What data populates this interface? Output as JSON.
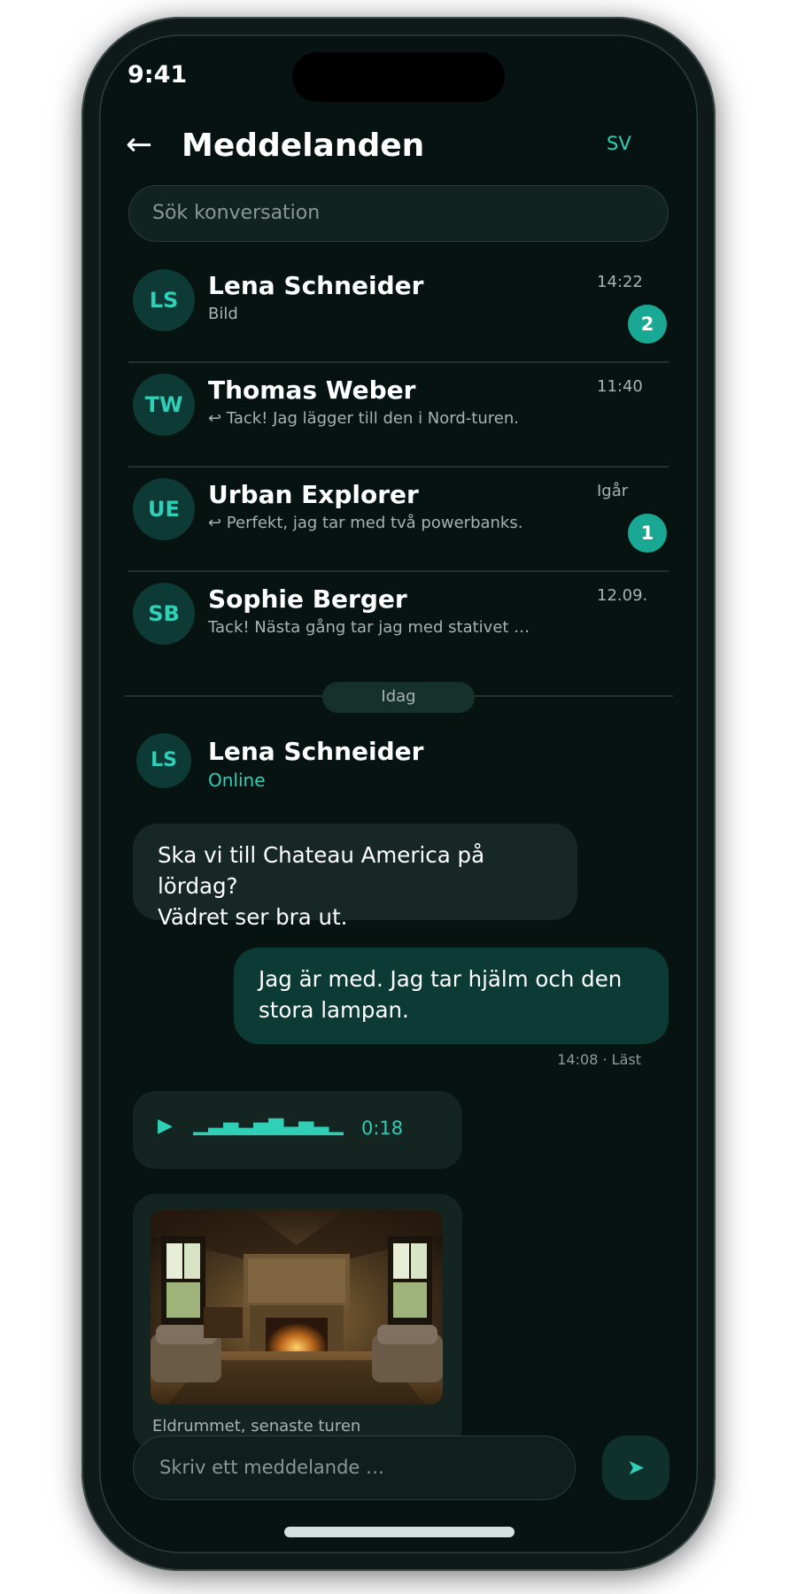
{
  "status_bar": {
    "time": "9:41"
  },
  "header": {
    "back_icon": "arrow-left-icon",
    "back_glyph": "←",
    "title": "Meddelanden",
    "language": "SV"
  },
  "search": {
    "placeholder": "Sök konversation"
  },
  "conversations": [
    {
      "initials": "LS",
      "name": "Lena Schneider",
      "preview": "Bild",
      "time": "14:22",
      "unread": "2"
    },
    {
      "initials": "TW",
      "name": "Thomas Weber",
      "preview": "↩ Tack! Jag lägger till den i Nord-turen.",
      "time": "11:40",
      "unread": ""
    },
    {
      "initials": "UE",
      "name": "Urban Explorer",
      "preview": "↩ Perfekt, jag tar med två powerbanks.",
      "time": "Igår",
      "unread": "1"
    },
    {
      "initials": "SB",
      "name": "Sophie Berger",
      "preview": "Tack! Nästa gång tar jag med stativet …",
      "time": "12.09.",
      "unread": ""
    }
  ],
  "day_separator": "Idag",
  "chat": {
    "contact_initials": "LS",
    "contact_name": "Lena Schneider",
    "contact_status": "Online",
    "messages": {
      "incoming_1": {
        "line1": "Ska vi till Chateau America på lördag?",
        "line2": "Vädret ser bra ut."
      },
      "outgoing_1": {
        "line1": "Jag är med. Jag tar hjälm och den",
        "line2": "stora lampan.",
        "meta": "14:08 · Läst"
      },
      "voice": {
        "play_icon": "play-icon",
        "play_glyph": "▶",
        "duration": "0:18",
        "waveform_levels": [
          0.15,
          0.35,
          0.6,
          0.35,
          0.6,
          0.8,
          0.4,
          0.65,
          0.4,
          0.15
        ]
      },
      "image": {
        "caption": "Eldrummet, senaste turen"
      }
    }
  },
  "composer": {
    "placeholder": "Skriv ett meddelande …",
    "send_icon": "send-icon",
    "send_glyph": "➤"
  },
  "colors": {
    "accent": "#2fcfb8",
    "badge": "#19a894",
    "background": "#061311",
    "outgoing_bubble": "#0c3a35",
    "incoming_bubble": "#172724"
  }
}
